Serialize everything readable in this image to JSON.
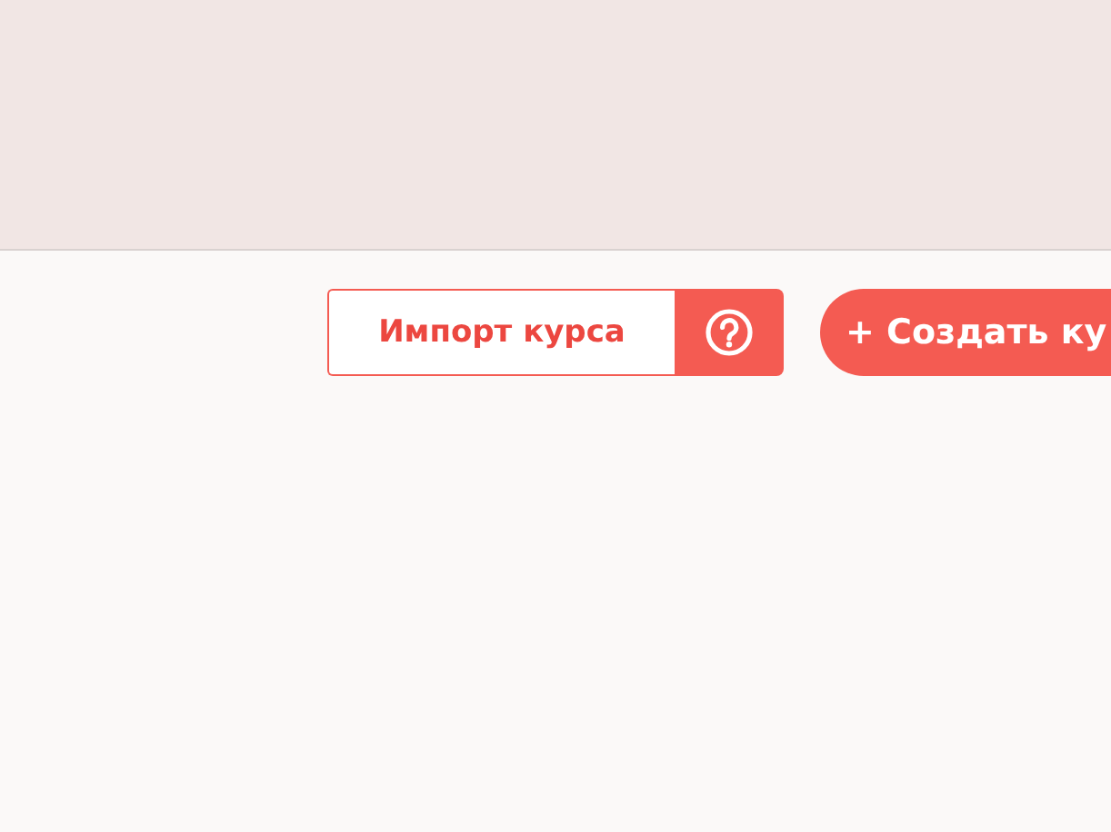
{
  "toolbar": {
    "import_button": "Импорт курса",
    "create_button": "+ Создать ку"
  }
}
